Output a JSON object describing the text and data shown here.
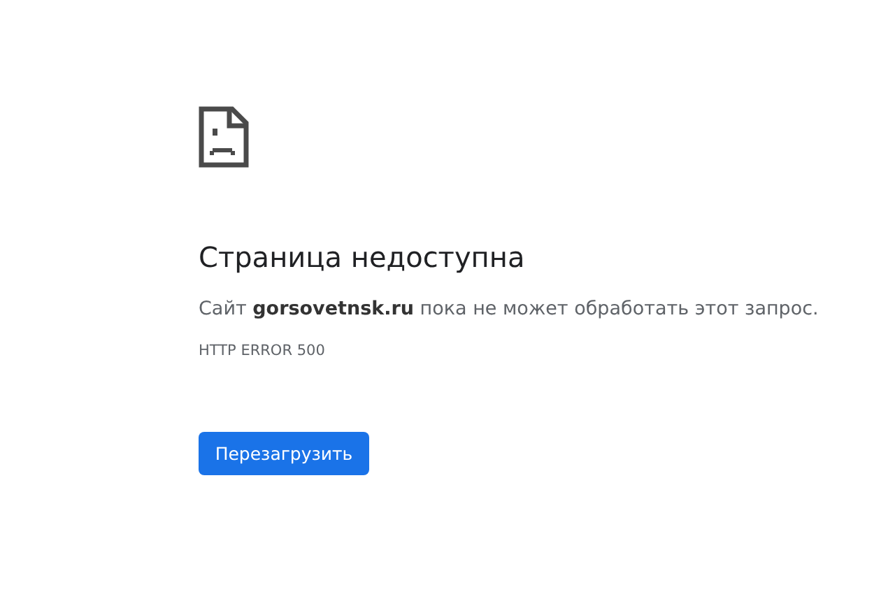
{
  "heading": "Страница недоступна",
  "message": "Сайт **gorsovetnsk.ru** пока не может обработать этот запрос.",
  "error_code": "HTTP ERROR 500",
  "reload_button": "Перезагрузить"
}
